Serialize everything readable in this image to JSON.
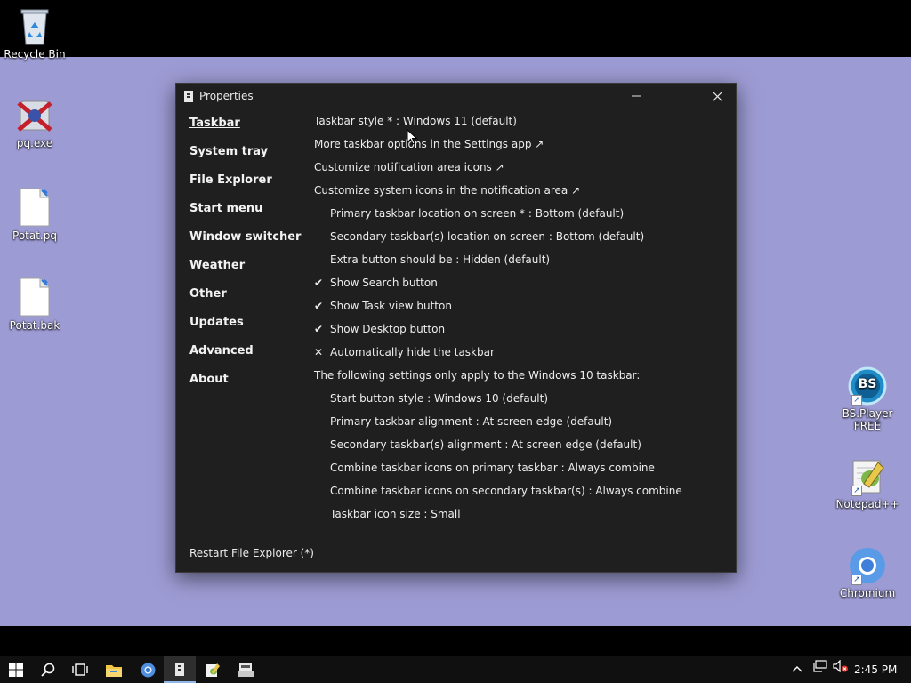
{
  "desktop": {
    "icons_left": [
      {
        "label": "Recycle Bin"
      },
      {
        "label": "pq.exe"
      },
      {
        "label": "Potat.pq"
      },
      {
        "label": "Potat.bak"
      }
    ],
    "icons_right": [
      {
        "label": "BS.Player FREE",
        "badge": "BS"
      },
      {
        "label": "Notepad++"
      },
      {
        "label": "Chromium"
      }
    ]
  },
  "window": {
    "title": "Properties",
    "nav": [
      "Taskbar",
      "System tray",
      "File Explorer",
      "Start menu",
      "Window switcher",
      "Weather",
      "Other",
      "Updates",
      "Advanced",
      "About"
    ],
    "active_nav": "Taskbar",
    "settings": [
      {
        "text": "Taskbar style * : Windows 11 (default)",
        "indent": false,
        "mark": ""
      },
      {
        "text": "More taskbar options in the Settings app ↗",
        "indent": false,
        "mark": ""
      },
      {
        "text": "Customize notification area icons ↗",
        "indent": false,
        "mark": ""
      },
      {
        "text": "Customize system icons in the notification area ↗",
        "indent": false,
        "mark": ""
      },
      {
        "text": "Primary taskbar location on screen * : Bottom (default)",
        "indent": true,
        "mark": ""
      },
      {
        "text": "Secondary taskbar(s) location on screen : Bottom (default)",
        "indent": true,
        "mark": ""
      },
      {
        "text": "Extra button should be : Hidden (default)",
        "indent": true,
        "mark": ""
      },
      {
        "text": "Show Search button",
        "indent": true,
        "mark": "✔"
      },
      {
        "text": "Show Task view button",
        "indent": true,
        "mark": "✔"
      },
      {
        "text": "Show Desktop button",
        "indent": true,
        "mark": "✔"
      },
      {
        "text": "Automatically hide the taskbar",
        "indent": true,
        "mark": "✕"
      },
      {
        "text": "The following settings only apply to the Windows 10 taskbar:",
        "indent": false,
        "mark": ""
      },
      {
        "text": "Start button style : Windows 10 (default)",
        "indent": true,
        "mark": ""
      },
      {
        "text": "Primary taskbar alignment : At screen edge (default)",
        "indent": true,
        "mark": ""
      },
      {
        "text": "Secondary taskbar(s) alignment : At screen edge (default)",
        "indent": true,
        "mark": ""
      },
      {
        "text": "Combine taskbar icons on primary taskbar : Always combine",
        "indent": true,
        "mark": ""
      },
      {
        "text": "Combine taskbar icons on secondary taskbar(s) : Always combine",
        "indent": true,
        "mark": ""
      },
      {
        "text": "Taskbar icon size : Small",
        "indent": true,
        "mark": ""
      }
    ],
    "restart_link": "Restart File Explorer (*)"
  },
  "taskbar": {
    "clock": "2:45 PM",
    "icons": [
      "windows-start-icon",
      "search-icon",
      "task-view-icon",
      "file-explorer-icon",
      "chromium-icon",
      "properties-app-icon",
      "notepad-plus-plus-icon",
      "taskbar-app-icon"
    ],
    "tray_icons": [
      "chevron-up-icon",
      "network-icon",
      "volume-muted-icon"
    ]
  },
  "colors": {
    "desktop_band": "#9d9bd3",
    "window_bg": "#1f1f1f",
    "taskbar_bg": "#101010",
    "active_indicator": "#8fb7ea"
  }
}
